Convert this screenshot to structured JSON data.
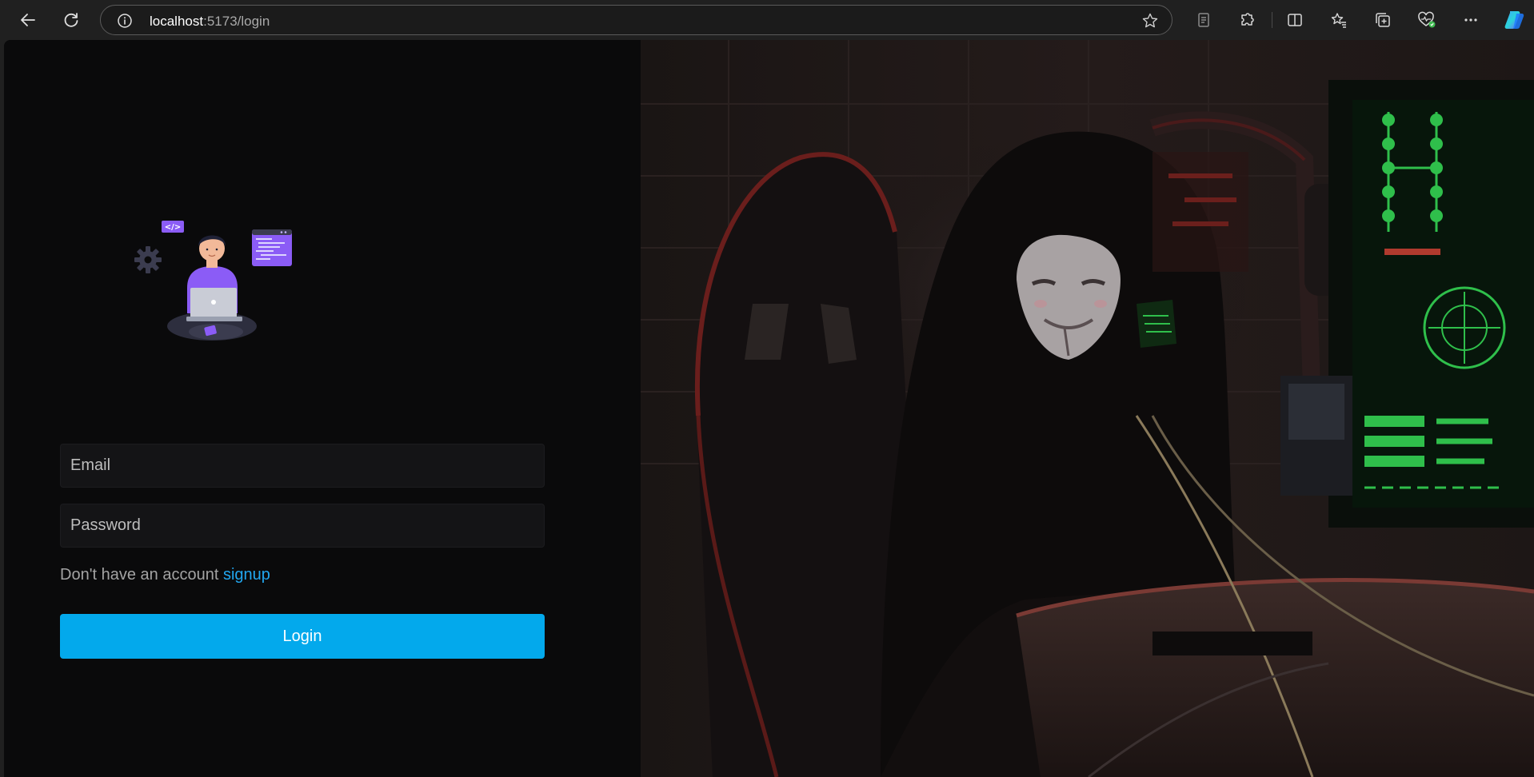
{
  "browser": {
    "url_host": "localhost",
    "url_path": ":5173/login",
    "icons": [
      "back-arrow-icon",
      "refresh-icon",
      "site-info-icon",
      "favorite-star-icon",
      "reading-mode-icon",
      "extensions-icon",
      "split-screen-icon",
      "favorites-icon",
      "collections-icon",
      "browser-essentials-icon",
      "more-icon",
      "copilot-icon"
    ]
  },
  "login": {
    "email_placeholder": "Email",
    "password_placeholder": "Password",
    "signup_prompt": "Don't have an account",
    "signup_link": "signup",
    "login_button": "Login",
    "illustration_code_tag": "</>"
  },
  "colors": {
    "accent": "#03a9ec",
    "link": "#22a7f0",
    "page_bg": "#0a0a0b",
    "field_bg": "#141416",
    "illustration_purple": "#8b5cf6"
  }
}
